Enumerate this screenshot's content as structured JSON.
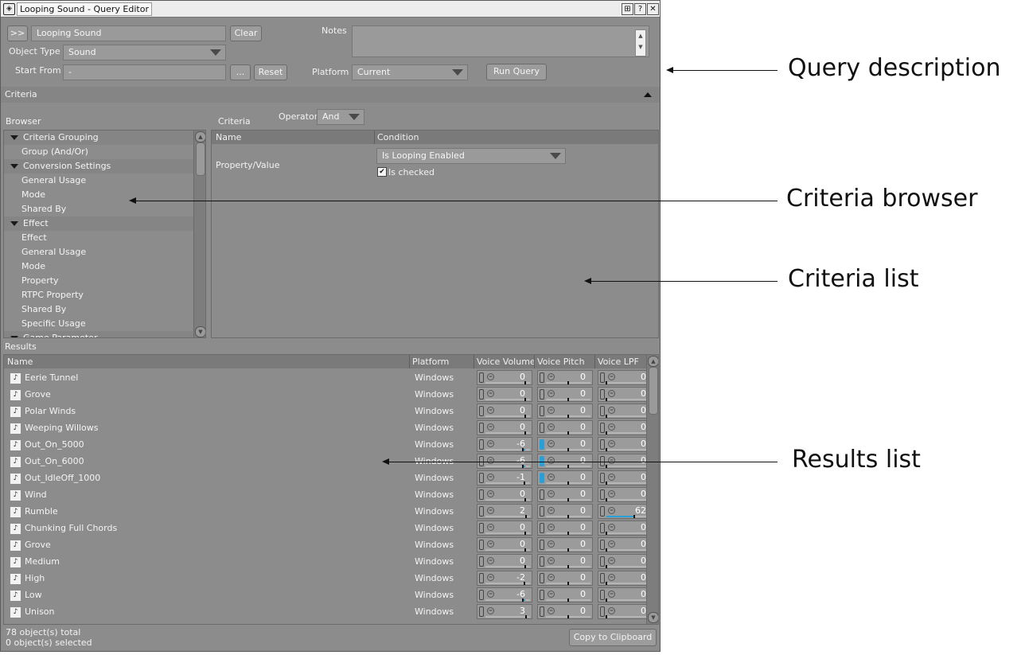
{
  "window": {
    "title": "Looping Sound - Query Editor",
    "icon": "wwise-app-icon",
    "buttons": [
      "layout-icon",
      "help-icon",
      "close-icon"
    ],
    "btn_layout": "⊞",
    "btn_help": "?",
    "btn_close": "✕"
  },
  "query": {
    "expand_label": ">>",
    "name_value": "Looping Sound",
    "clear_label": "Clear",
    "notes_label": "Notes",
    "object_type_label": "Object Type",
    "object_type_value": "Sound",
    "start_from_label": "Start From",
    "start_from_value": "-",
    "browse_label": "...",
    "reset_label": "Reset",
    "platform_label": "Platform",
    "platform_value": "Current",
    "run_label": "Run Query"
  },
  "criteria": {
    "section_label": "Criteria",
    "browser_label": "Browser",
    "list_label": "Criteria",
    "operator_label": "Operator",
    "operator_value": "And",
    "browser_items": [
      {
        "label": "Criteria Grouping",
        "group": true
      },
      {
        "label": "Group (And/Or)",
        "group": false
      },
      {
        "label": "Conversion Settings",
        "group": true
      },
      {
        "label": "General Usage",
        "group": false
      },
      {
        "label": "Mode",
        "group": false
      },
      {
        "label": "Shared By",
        "group": false
      },
      {
        "label": "Effect",
        "group": true
      },
      {
        "label": "Effect",
        "group": false
      },
      {
        "label": "General Usage",
        "group": false
      },
      {
        "label": "Mode",
        "group": false
      },
      {
        "label": "Property",
        "group": false
      },
      {
        "label": "RTPC Property",
        "group": false
      },
      {
        "label": "Shared By",
        "group": false
      },
      {
        "label": "Specific Usage",
        "group": false
      },
      {
        "label": "Game Parameter",
        "group": true
      }
    ],
    "columns": {
      "name": "Name",
      "condition": "Condition"
    },
    "row": {
      "name": "Property/Value",
      "condition_value": "Is Looping Enabled",
      "checkbox_label": "Is checked",
      "checked": true
    }
  },
  "results": {
    "section_label": "Results",
    "columns": [
      "Name",
      "Platform",
      "Voice Volume",
      "Voice Pitch",
      "Voice LPF"
    ],
    "rows": [
      {
        "name": "Eerie Tunnel",
        "platform": "Windows",
        "volume": 0,
        "pitch": 0,
        "lpf": 0
      },
      {
        "name": "Grove",
        "platform": "Windows",
        "volume": 0,
        "pitch": 0,
        "lpf": 0
      },
      {
        "name": "Polar Winds",
        "platform": "Windows",
        "volume": 0,
        "pitch": 0,
        "lpf": 0
      },
      {
        "name": "Weeping Willows",
        "platform": "Windows",
        "volume": 0,
        "pitch": 0,
        "lpf": 0
      },
      {
        "name": "Out_On_5000",
        "platform": "Windows",
        "volume": -6,
        "pitch": 0,
        "lpf": 0
      },
      {
        "name": "Out_On_6000",
        "platform": "Windows",
        "volume": -6,
        "pitch": 0,
        "lpf": 0
      },
      {
        "name": "Out_IdleOff_1000",
        "platform": "Windows",
        "volume": -1,
        "pitch": 0,
        "lpf": 0
      },
      {
        "name": "Wind",
        "platform": "Windows",
        "volume": 0,
        "pitch": 0,
        "lpf": 0
      },
      {
        "name": "Rumble",
        "platform": "Windows",
        "volume": 2,
        "pitch": 0,
        "lpf": 62
      },
      {
        "name": "Chunking Full Chords",
        "platform": "Windows",
        "volume": 0,
        "pitch": 0,
        "lpf": 0
      },
      {
        "name": "Grove",
        "platform": "Windows",
        "volume": 0,
        "pitch": 0,
        "lpf": 0
      },
      {
        "name": "Medium",
        "platform": "Windows",
        "volume": 0,
        "pitch": 0,
        "lpf": 0
      },
      {
        "name": "High",
        "platform": "Windows",
        "volume": -2,
        "pitch": 0,
        "lpf": 0
      },
      {
        "name": "Low",
        "platform": "Windows",
        "volume": -6,
        "pitch": 0,
        "lpf": 0
      },
      {
        "name": "Unison",
        "platform": "Windows",
        "volume": 3,
        "pitch": 0,
        "lpf": 0
      }
    ],
    "total_label": "78 object(s) total",
    "selected_label": "0 object(s) selected",
    "copy_label": "Copy to Clipboard"
  },
  "annotations": [
    {
      "text": "Query description"
    },
    {
      "text": "Criteria browser"
    },
    {
      "text": "Criteria list"
    },
    {
      "text": "Results list"
    }
  ],
  "colors": {
    "panel": "#8c8c8c",
    "accent": "#2a9fd6",
    "header": "#7a7a7a"
  }
}
